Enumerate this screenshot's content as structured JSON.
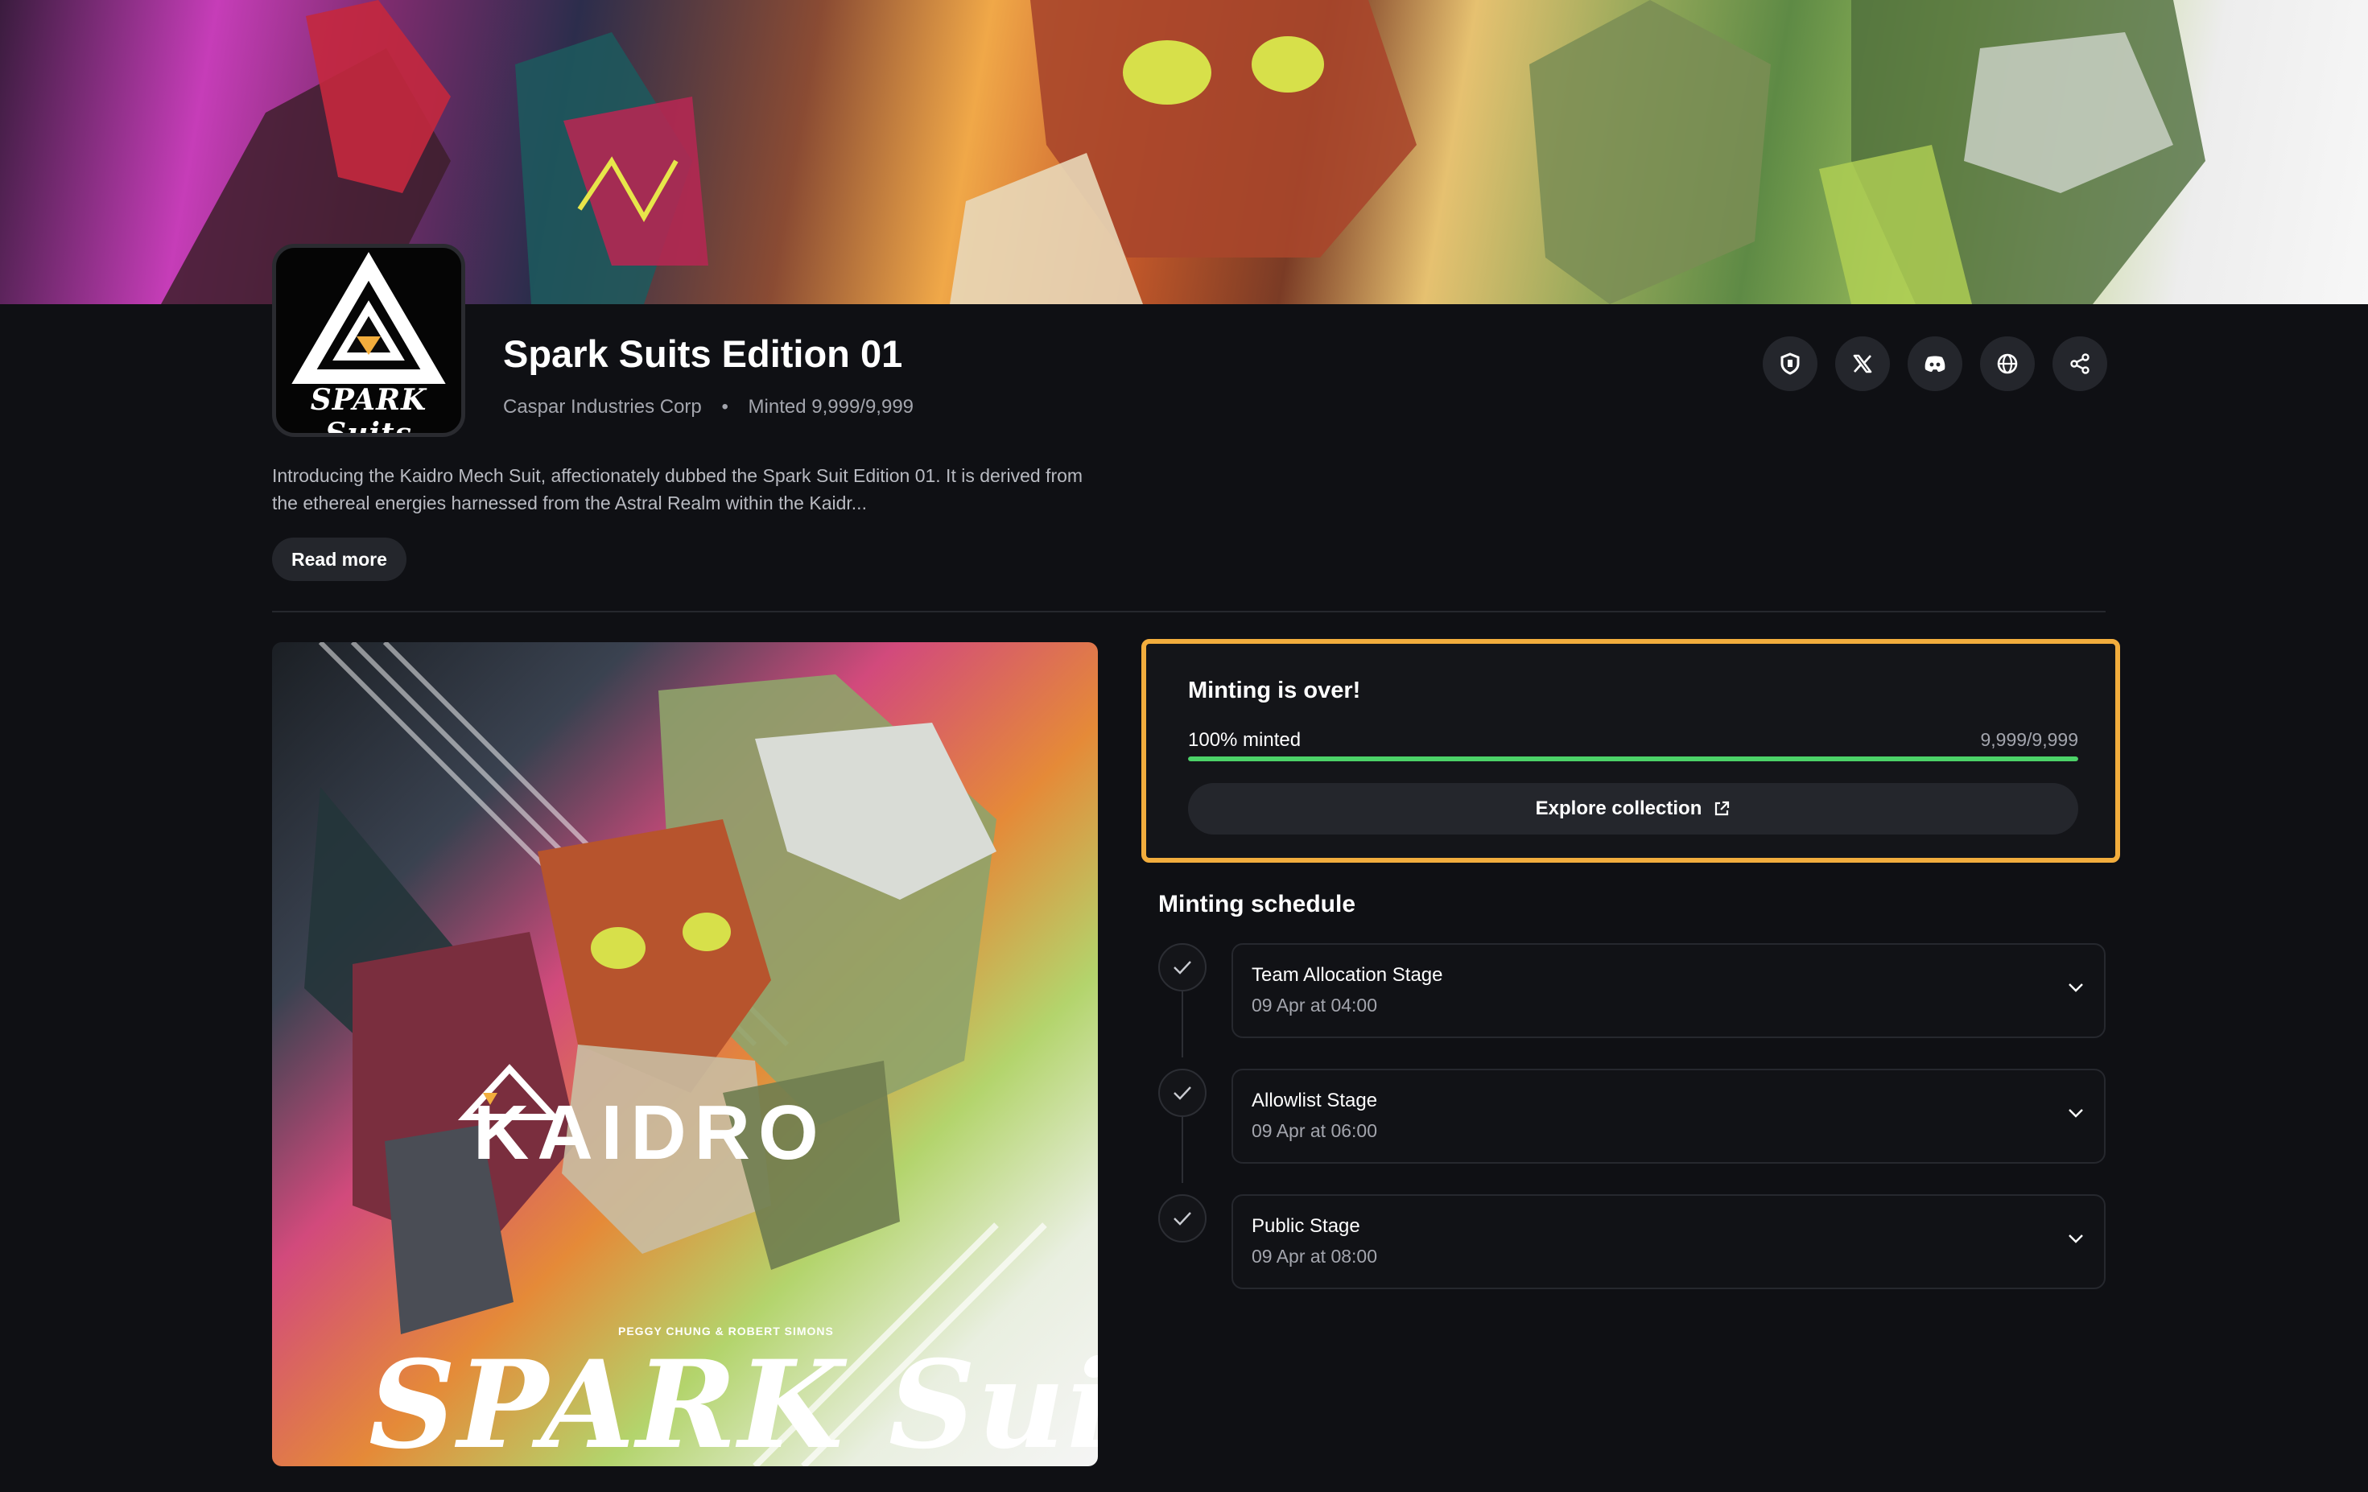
{
  "collection": {
    "title": "Spark Suits Edition 01",
    "creator": "Caspar Industries Corp",
    "minted_text": "Minted 9,999/9,999",
    "logo_text": "SPARK Suits",
    "description": "Introducing the Kaidro Mech Suit, affectionately dubbed the Spark Suit Edition 01. It is derived from the ethereal energies harnessed from the Astral Realm within the Kaidr...",
    "read_more_label": "Read more"
  },
  "social": {
    "icons": [
      "shield-icon",
      "x-icon",
      "discord-icon",
      "globe-icon",
      "share-icon"
    ]
  },
  "artwork": {
    "brand": "KAIDRO",
    "authors": "PEGGY CHUNG & ROBERT SIMONS",
    "series": "SPARK Suits"
  },
  "mint_status": {
    "title": "Minting is over!",
    "progress_label": "100% minted",
    "progress_count": "9,999/9,999",
    "progress_fraction": 1.0,
    "explore_label": "Explore collection",
    "accent_color": "#f2ad3d",
    "progress_color": "#4cd268"
  },
  "schedule": {
    "title": "Minting schedule",
    "stages": [
      {
        "name": "Team Allocation Stage",
        "date": "09 Apr at 04:00"
      },
      {
        "name": "Allowlist Stage",
        "date": "09 Apr at 06:00"
      },
      {
        "name": "Public Stage",
        "date": "09 Apr at 08:00"
      }
    ]
  }
}
